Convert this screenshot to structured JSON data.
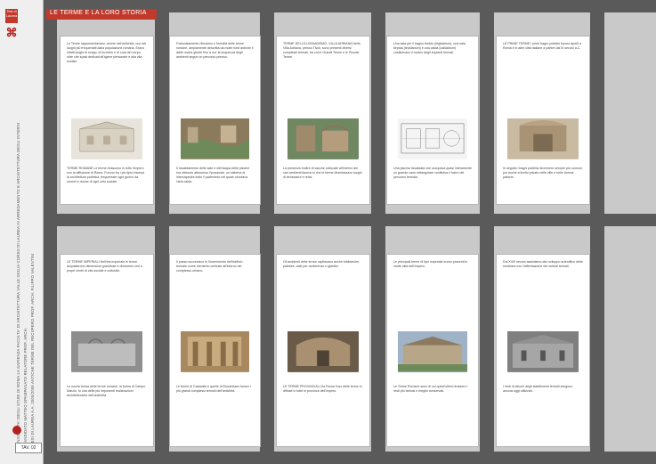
{
  "header": {
    "title": "LE TERME E LA LORO STORIA"
  },
  "strip": {
    "logo_top": "Tesi di Laurea",
    "mark": "⌘",
    "vertical_line_1": "UNIVERSITA' DEGLI STUDI DI ROMA LA SAPIENZA   FACOLTA' DI ARCHITETTURA VALLE GIULIA   CORSO DI LAUREA IN ARREDAMENTO E ARCHITETTURA DEGLI INTERNI",
    "vertical_line_2": "CANDIDATO   MATTEO SPAMPANATO   RELATORE   PROF. ARCH.",
    "vertical_line_3": "TESI DI LAUREA   A.A. 2005/2006   ANTICHE TERME   DEL RECUPERO   PROF. ARCH. FILIPPO VALENTINI",
    "tav": "TAV. 02"
  },
  "pages_row1": [
    {
      "top": "Le Terme rappresentavano, anche nell'antichità, uno dei luoghi più frequentati dalla popolazione romana. Erano infatti luoghi di svago, di incontro e di cura del corpo, oltre che spazi dedicati all'igiene personale e alla vita sociale.",
      "bottom": "TERME ROMANE\nLe terme rinascono in tutto l'Impero con la diffusione di Roma. Furono fra i più tipici esempi di architettura pubblica, frequentate ogni giorno da uomini e donne di ogni ceto sociale."
    },
    {
      "top": "Fortunatamente rileviamo e l'eredità delle terme romane, ampiamente descritta da molte fonti antiche e dalle rovine giunte fino a noi: la sequenza degli ambienti segue un percorso preciso.",
      "bottom": "Il riscaldamento delle sale e dell'acqua delle piscine era ottenuto attraverso l'ipocausto, un sistema di intercapedini sotto il pavimento nel quale circolava l'aria calda."
    },
    {
      "top": "TERME DELL'ELIODIANISMO, VILLA ADRIANA\nNella Villa Adriana, presso Tivoli, sono presenti diversi complessi termali, tra cui le Grandi Terme e le Piccole Terme.",
      "bottom": "La presenza inoltre di vasche collocate all'interno dei vari ambienti faceva sì che le terme diventassero luoghi di benessere e relax."
    },
    {
      "top": "Una sala per il bagno freddo (frigidarium), una sala tiepida (tepidarium) e una calda (calidarium) costituivano il nucleo degli impianti termali.",
      "bottom": "Una piscina riscaldata che occupava quasi interamente un grande vano rettangolare costituiva il fulcro del percorso termale."
    },
    {
      "top": "LE PRIME TERME\nI primi bagni pubblici furono aperti a Roma e in altre città italiane a partire dal III secolo a.C.",
      "bottom": "In seguito i bagni pubblici divennero sempre più comuni, poi anche a livello privato nelle ville e nelle domus patrizie."
    }
  ],
  "pages_row2": [
    {
      "top": "LE TERME IMPERIALI\nNell'età imperiale le terme acquistarono dimensioni grandiose e divennero veri e propri centri di vita sociale e culturale.",
      "bottom": "La nuova forma delle terme romane, la forma di Campo Marzio, fu una delle più imponenti realizzazioni architettoniche dell'antichità."
    },
    {
      "top": "Il passo successivo fu l'inserimento dell'edificio termale come elemento centrale all'interno del complesso urbano.",
      "bottom": "Le terme di Caracalla e quelle di Diocleziano furono i più grandi complessi termali dell'antichità."
    },
    {
      "top": "Gli ambienti delle terme ospitavano anche biblioteche, palestre, sale per conferenze e giardini.",
      "bottom": "LE TERME PROVINCIALI\nDa Roma l'uso delle terme si diffuse in tutte le province dell'Impero."
    },
    {
      "top": "Le principali terme di tipo imperiale erano presenti in molte città dell'Impero.",
      "bottom": "Le Terme Romane sono di cui quest'ultimi rimasero i resti più famosi e meglio conservati."
    },
    {
      "top": "Dal XVIII secolo assistiamo allo sviluppo scientifico della medicina con l'affermazione dei metodi termali.",
      "bottom": "I resti di alcune degli stabilimenti termali vengono ancora oggi utilizzati."
    }
  ]
}
